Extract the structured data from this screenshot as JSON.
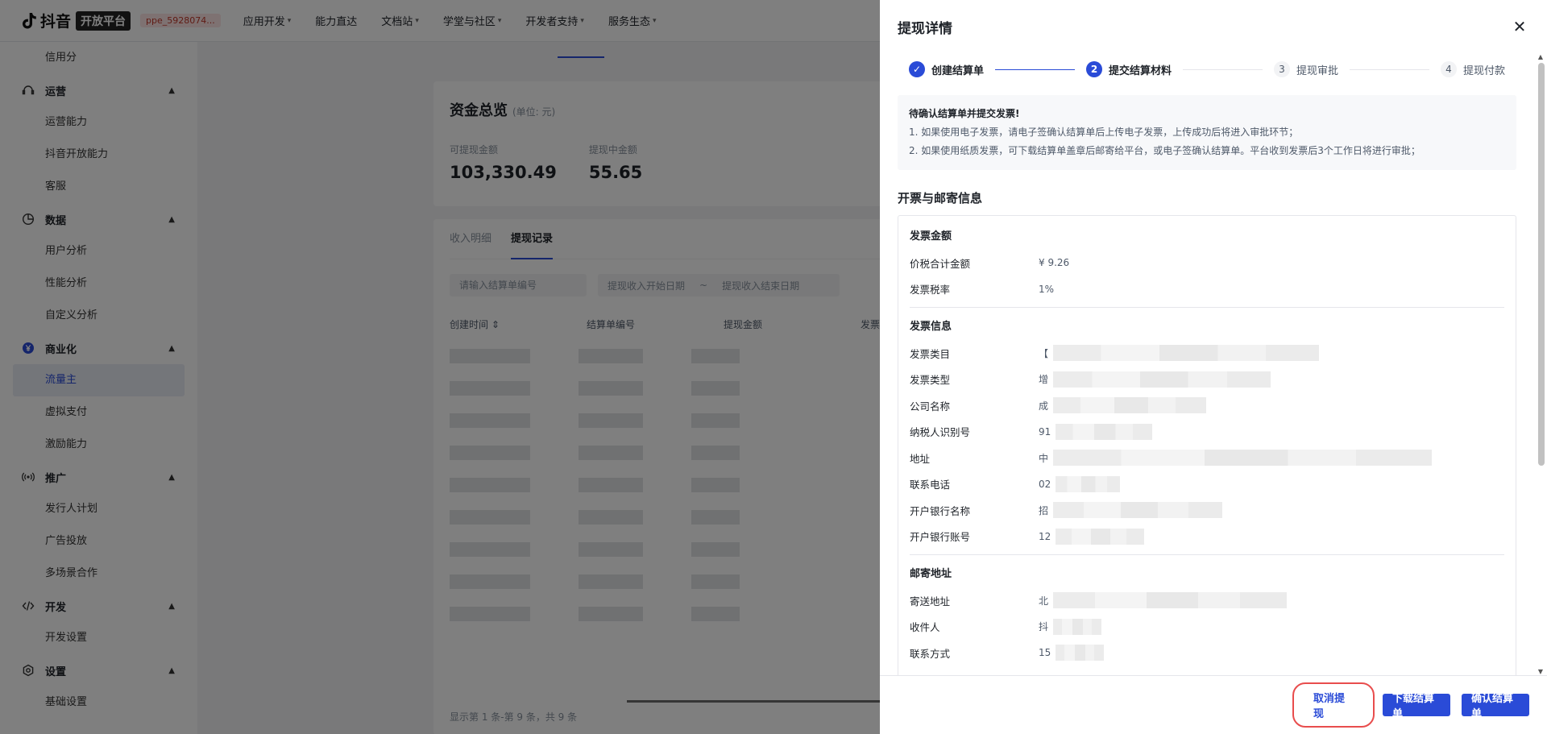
{
  "topnav": {
    "brand": "抖音",
    "brand_badge": "开放平台",
    "app_id": "ppe_5928074...",
    "menu": [
      "应用开发",
      "能力直达",
      "文档站",
      "学堂与社区",
      "开发者支持",
      "服务生态"
    ],
    "menu_has_caret": [
      true,
      false,
      true,
      true,
      true,
      true
    ]
  },
  "sidebar": {
    "top_item": "信用分",
    "groups": [
      {
        "label": "运营",
        "icon": "operations-icon",
        "items": [
          "运营能力",
          "抖音开放能力",
          "客服"
        ]
      },
      {
        "label": "数据",
        "icon": "data-pie-icon",
        "items": [
          "用户分析",
          "性能分析",
          "自定义分析"
        ]
      },
      {
        "label": "商业化",
        "icon": "yen-icon",
        "items": [
          "流量主",
          "虚拟支付",
          "激励能力"
        ]
      },
      {
        "label": "推广",
        "icon": "broadcast-icon",
        "items": [
          "发行人计划",
          "广告投放",
          "多场景合作"
        ]
      },
      {
        "label": "开发",
        "icon": "code-icon",
        "items": [
          "开发设置"
        ]
      },
      {
        "label": "设置",
        "icon": "settings-icon",
        "items": [
          "基础设置"
        ]
      }
    ],
    "active_item": "流量主"
  },
  "funds": {
    "title": "资金总览",
    "unit": "(单位: 元)",
    "available_label": "可提现金额",
    "available_value": "103,330.49",
    "pending_label": "提现中金额",
    "pending_value": "55.65"
  },
  "records": {
    "tabs": [
      "收入明细",
      "提现记录"
    ],
    "active_tab": "提现记录",
    "settlement_placeholder": "请输入结算单编号",
    "start_placeholder": "提现收入开始日期",
    "range_sep": "~",
    "end_placeholder": "提现收入结束日期",
    "columns": [
      "创建时间",
      "结算单编号",
      "提现金额",
      "发票税"
    ],
    "pager": "显示第 1 条-第 9 条，共 9 条"
  },
  "drawer": {
    "title": "提现详情",
    "close_glyph": "✕",
    "steps": [
      {
        "num": "✓",
        "label": "创建结算单",
        "state": "done"
      },
      {
        "num": "2",
        "label": "提交结算材料",
        "state": "current"
      },
      {
        "num": "3",
        "label": "提现审批",
        "state": "pending"
      },
      {
        "num": "4",
        "label": "提现付款",
        "state": "pending"
      }
    ],
    "notice": {
      "title": "待确认结算单并提交发票!",
      "line1": "1. 如果使用电子发票，请电子签确认结算单后上传电子发票，上传成功后将进入审批环节；",
      "line2": "2. 如果使用纸质发票，可下载结算单盖章后邮寄给平台，或电子签确认结算单。平台收到发票后3个工作日将进行审批；"
    },
    "section_title": "开票与邮寄信息",
    "invoice_amount": {
      "title": "发票金额",
      "rows": [
        {
          "k": "价税合计金额",
          "v": "¥ 9.26"
        },
        {
          "k": "发票税率",
          "v": "1%"
        }
      ]
    },
    "invoice_info": {
      "title": "发票信息",
      "rows": [
        {
          "k": "发票类目",
          "v": "【"
        },
        {
          "k": "发票类型",
          "v": "增"
        },
        {
          "k": "公司名称",
          "v": "成"
        },
        {
          "k": "纳税人识别号",
          "v": "91"
        },
        {
          "k": "地址",
          "v": "中"
        },
        {
          "k": "联系电话",
          "v": "02"
        },
        {
          "k": "开户银行名称",
          "v": "招"
        },
        {
          "k": "开户银行账号",
          "v": "12"
        }
      ]
    },
    "mailing": {
      "title": "邮寄地址",
      "rows": [
        {
          "k": "寄送地址",
          "v": "北"
        },
        {
          "k": "收件人",
          "v": "抖"
        },
        {
          "k": "联系方式",
          "v": "15"
        }
      ]
    },
    "buttons": {
      "cancel": "取消提现",
      "download": "下载结算单",
      "confirm": "确认结算单"
    }
  },
  "colors": {
    "primary": "#2a4bd7",
    "highlight": "#e84d4d",
    "overlay": "rgba(0,0,0,0.5)"
  }
}
